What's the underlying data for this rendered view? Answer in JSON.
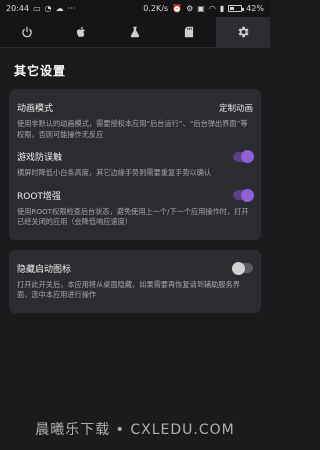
{
  "status": {
    "time": "20:44",
    "speed": "0.2K/s",
    "battery": "42%",
    "battery_fraction": 0.42,
    "left_icons": [
      "message-icon",
      "chat-icon",
      "cloud-icon",
      "dots-icon"
    ],
    "right_icons": [
      "alarm-icon",
      "settings-icon",
      "vpn-icon",
      "wifi-icon",
      "signal-icon",
      "battery-icon"
    ]
  },
  "tabs": [
    {
      "icon": "power-icon",
      "active": false
    },
    {
      "icon": "apple-icon",
      "active": false
    },
    {
      "icon": "flask-icon",
      "active": false
    },
    {
      "icon": "sdcard-icon",
      "active": false
    },
    {
      "icon": "gear-icon",
      "active": true
    }
  ],
  "page": {
    "title": "其它设置"
  },
  "cards": {
    "animation": {
      "title": "动画模式",
      "value": "定制动画",
      "desc": "使用非默认的动画模式，需要授权本应用“后台运行”、“后台弹出界面”等权限，否则可能操作无反应"
    },
    "anti_touch": {
      "title": "游戏防误触",
      "desc": "横屏时降低小白条高度，其它边缘手势则需要重复手势以确认",
      "toggle_on": true
    },
    "root_boost": {
      "title": "ROOT增强",
      "desc": "使用ROOT权限检查后台状态，避免使用上一个/下一个应用操作时，打开已经关闭的应用（会降低响应速度）",
      "toggle_on": true
    },
    "hide_icon": {
      "title": "隐藏启动图标",
      "desc": "打开此开关后，本应用将从桌面隐藏，如果需要再恢复请到辅助服务界面，选中本应用进行操作",
      "toggle_on": false
    }
  },
  "watermark": "晨曦乐下载 • CXLEDU.COM"
}
